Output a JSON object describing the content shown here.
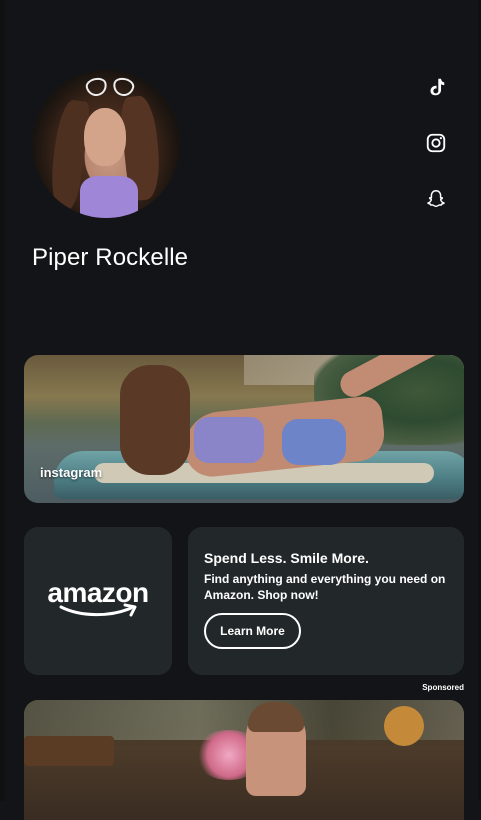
{
  "profile": {
    "name": "Piper Rockelle",
    "avatar": "profile-photo"
  },
  "social_links": [
    {
      "name": "tiktok",
      "icon": "tiktok-icon"
    },
    {
      "name": "instagram",
      "icon": "instagram-icon"
    },
    {
      "name": "snapchat",
      "icon": "snapchat-icon"
    }
  ],
  "links": [
    {
      "label": "instagram",
      "type": "image-card"
    }
  ],
  "ad": {
    "brand": "amazon",
    "title": "Spend Less. Smile More.",
    "description": "Find anything and everything you need on Amazon. Shop now!",
    "cta": "Learn More",
    "sponsored_label": "Sponsored"
  },
  "colors": {
    "background": "#131417",
    "card": "#22282a",
    "text": "#ffffff"
  }
}
